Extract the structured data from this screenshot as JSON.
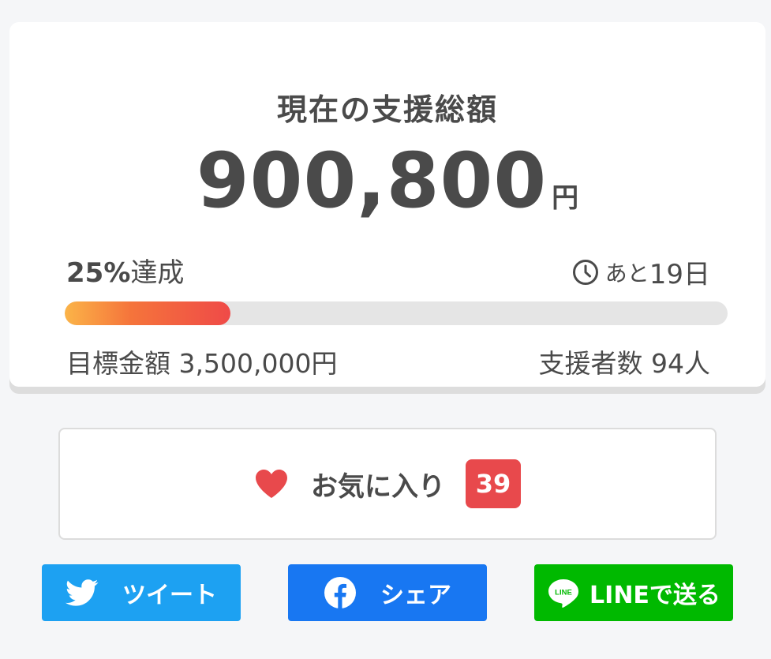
{
  "summary": {
    "title": "現在の支援総額",
    "amount": "900,800",
    "amount_unit": "円",
    "rate_number": "25%",
    "rate_suffix": "達成",
    "progress_fraction": 0.25,
    "days_prefix": "あと",
    "days_value": "19日",
    "goal_text": "目標金額 3,500,000円",
    "supporters_text": "支援者数 94人"
  },
  "favorite": {
    "label": "お気に入り",
    "count": "39"
  },
  "share": {
    "twitter_label": "ツイート",
    "facebook_label": "シェア",
    "line_label": "LINEで送る"
  },
  "icons": {
    "clock": "clock-icon",
    "heart": "heart-icon",
    "twitter": "twitter-bird-icon",
    "facebook": "facebook-f-icon",
    "line": "line-logo-icon"
  },
  "colors": {
    "heart": "#e8494c",
    "badge": "#e8494c",
    "twitter": "#1da1f2",
    "facebook": "#1877f2",
    "line": "#00b900",
    "progress_start": "#fbb448",
    "progress_end": "#ef4a48"
  }
}
